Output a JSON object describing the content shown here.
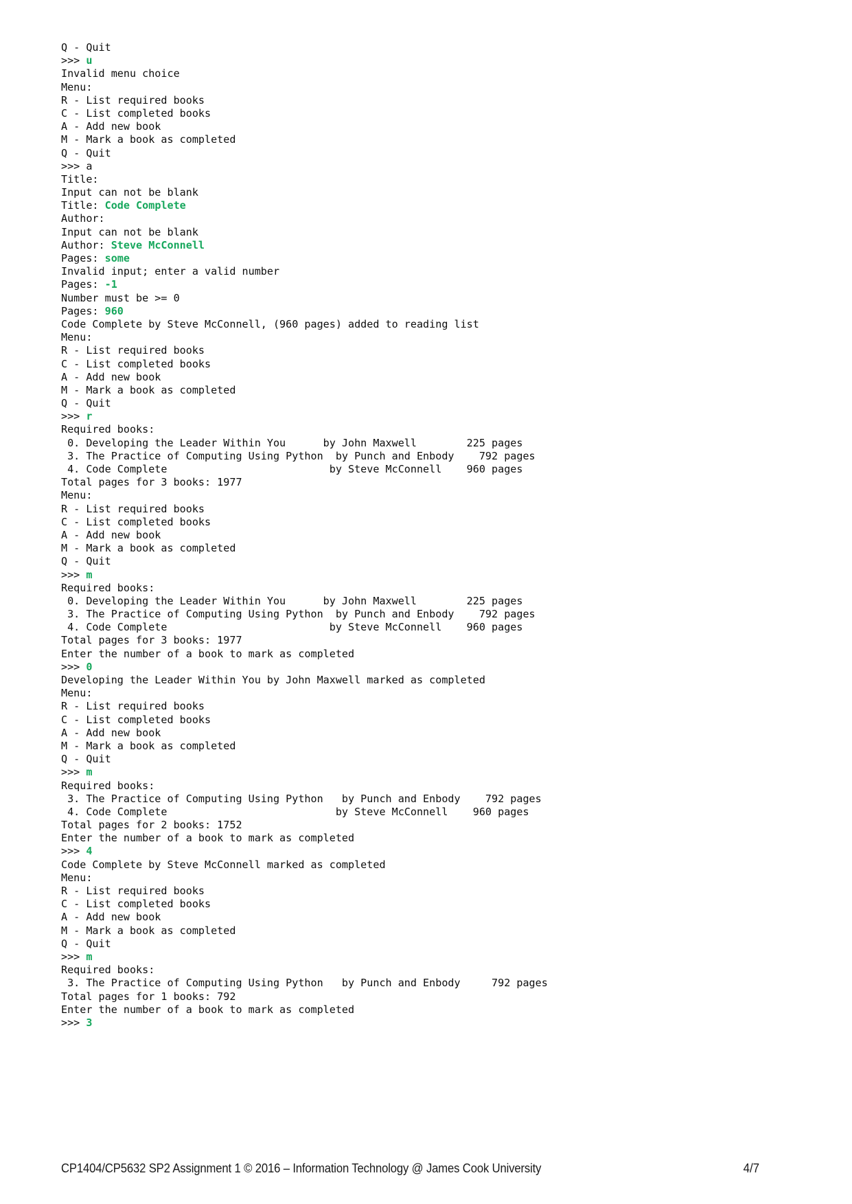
{
  "document": {
    "type": "assignment-pdf-page",
    "page_label": "4/7",
    "footer_text": "CP1404/CP5632 SP2 Assignment 1 © 2016 – Information Technology @ James Cook University",
    "colors": {
      "background": "#ffffff",
      "text": "#0d0d0d",
      "user_input": "#16a75c"
    }
  },
  "console": {
    "prompt": ">>> ",
    "menu_header": "Menu:",
    "menu_items": [
      "R - List required books",
      "C - List completed books",
      "A - Add new book",
      "M - Mark a book as completed",
      "Q - Quit"
    ],
    "lines": [
      {
        "text": "Q - Quit"
      },
      {
        "text": ">>> ",
        "input": "u"
      },
      {
        "text": "Invalid menu choice"
      },
      {
        "text": "Menu:"
      },
      {
        "text": "R - List required books"
      },
      {
        "text": "C - List completed books"
      },
      {
        "text": "A - Add new book"
      },
      {
        "text": "M - Mark a book as completed"
      },
      {
        "text": "Q - Quit"
      },
      {
        "text": ">>> a"
      },
      {
        "text": "Title:"
      },
      {
        "text": "Input can not be blank"
      },
      {
        "text": "Title: ",
        "input": "Code Complete"
      },
      {
        "text": "Author:"
      },
      {
        "text": "Input can not be blank"
      },
      {
        "text": "Author: ",
        "input": "Steve McConnell"
      },
      {
        "text": "Pages: ",
        "input": "some"
      },
      {
        "text": "Invalid input; enter a valid number"
      },
      {
        "text": "Pages: ",
        "input": "-1"
      },
      {
        "text": "Number must be >= 0"
      },
      {
        "text": "Pages: ",
        "input": "960"
      },
      {
        "text": "Code Complete by Steve McConnell, (960 pages) added to reading list"
      },
      {
        "text": "Menu:"
      },
      {
        "text": "R - List required books"
      },
      {
        "text": "C - List completed books"
      },
      {
        "text": "A - Add new book"
      },
      {
        "text": "M - Mark a book as completed"
      },
      {
        "text": "Q - Quit"
      },
      {
        "text": ">>> ",
        "input": "r"
      },
      {
        "text": "Required books:"
      },
      {
        "text": " 0. Developing the Leader Within You      by John Maxwell        225 pages"
      },
      {
        "text": " 3. The Practice of Computing Using Python  by Punch and Enbody    792 pages"
      },
      {
        "text": " 4. Code Complete                          by Steve McConnell    960 pages"
      },
      {
        "text": "Total pages for 3 books: 1977"
      },
      {
        "text": "Menu:"
      },
      {
        "text": "R - List required books"
      },
      {
        "text": "C - List completed books"
      },
      {
        "text": "A - Add new book"
      },
      {
        "text": "M - Mark a book as completed"
      },
      {
        "text": "Q - Quit"
      },
      {
        "text": ">>> ",
        "input": "m"
      },
      {
        "text": "Required books:"
      },
      {
        "text": " 0. Developing the Leader Within You      by John Maxwell        225 pages"
      },
      {
        "text": " 3. The Practice of Computing Using Python  by Punch and Enbody    792 pages"
      },
      {
        "text": " 4. Code Complete                          by Steve McConnell    960 pages"
      },
      {
        "text": "Total pages for 3 books: 1977"
      },
      {
        "text": "Enter the number of a book to mark as completed"
      },
      {
        "text": ">>> ",
        "input": "0"
      },
      {
        "text": "Developing the Leader Within You by John Maxwell marked as completed"
      },
      {
        "text": "Menu:"
      },
      {
        "text": "R - List required books"
      },
      {
        "text": "C - List completed books"
      },
      {
        "text": "A - Add new book"
      },
      {
        "text": "M - Mark a book as completed"
      },
      {
        "text": "Q - Quit"
      },
      {
        "text": ">>> ",
        "input": "m"
      },
      {
        "text": "Required books:"
      },
      {
        "text": " 3. The Practice of Computing Using Python   by Punch and Enbody    792 pages"
      },
      {
        "text": " 4. Code Complete                           by Steve McConnell    960 pages"
      },
      {
        "text": "Total pages for 2 books: 1752"
      },
      {
        "text": "Enter the number of a book to mark as completed"
      },
      {
        "text": ">>> ",
        "input": "4"
      },
      {
        "text": "Code Complete by Steve McConnell marked as completed"
      },
      {
        "text": "Menu:"
      },
      {
        "text": "R - List required books"
      },
      {
        "text": "C - List completed books"
      },
      {
        "text": "A - Add new book"
      },
      {
        "text": "M - Mark a book as completed"
      },
      {
        "text": "Q - Quit"
      },
      {
        "text": ">>> ",
        "input": "m"
      },
      {
        "text": "Required books:"
      },
      {
        "text": " 3. The Practice of Computing Using Python   by Punch and Enbody     792 pages"
      },
      {
        "text": "Total pages for 1 books: 792"
      },
      {
        "text": "Enter the number of a book to mark as completed"
      },
      {
        "text": ">>> ",
        "input": "3"
      }
    ],
    "books": [
      {
        "index": "0",
        "title": "Developing the Leader Within You",
        "author": "John Maxwell",
        "pages": "225"
      },
      {
        "index": "3",
        "title": "The Practice of Computing Using Python",
        "author": "Punch and Enbody",
        "pages": "792"
      },
      {
        "index": "4",
        "title": "Code Complete",
        "author": "Steve McConnell",
        "pages": "960"
      }
    ],
    "totals": [
      "Total pages for 3 books: 1977",
      "Total pages for 2 books: 1752",
      "Total pages for 1 books: 792"
    ],
    "messages": [
      "Invalid menu choice",
      "Input can not be blank",
      "Invalid input; enter a valid number",
      "Number must be >= 0",
      "Code Complete by Steve McConnell, (960 pages) added to reading list",
      "Enter the number of a book to mark as completed",
      "Developing the Leader Within You by John Maxwell marked as completed",
      "Code Complete by Steve McConnell marked as completed"
    ],
    "prompts": [
      "Title:",
      "Author:",
      "Pages:"
    ]
  }
}
